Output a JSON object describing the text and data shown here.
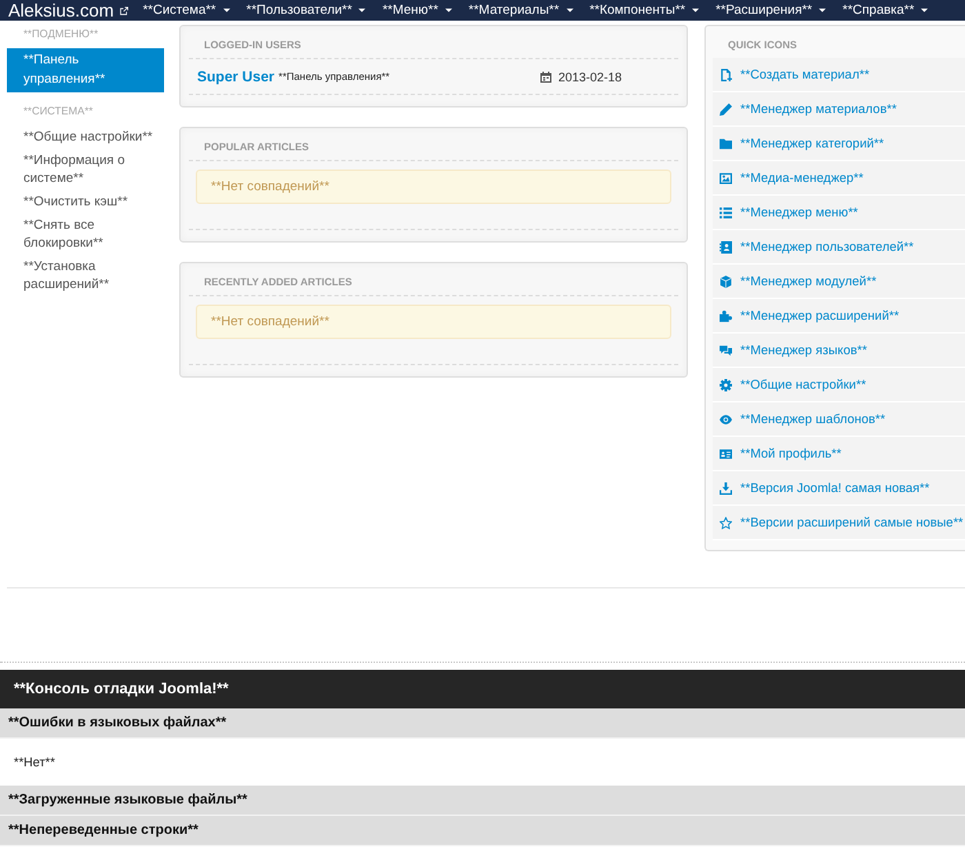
{
  "navbar": {
    "brand": "Aleksius.com",
    "menus": [
      {
        "label": "**Система**"
      },
      {
        "label": "**Пользователи**"
      },
      {
        "label": "**Меню**"
      },
      {
        "label": "**Материалы**"
      },
      {
        "label": "**Компоненты**"
      },
      {
        "label": "**Расширения**"
      },
      {
        "label": "**Справка**"
      }
    ]
  },
  "sidebar": {
    "sections": [
      {
        "title": "**ПОДМЕНЮ**",
        "items": [
          {
            "label": "**Панель управления**",
            "selected": true
          }
        ]
      },
      {
        "title": "**СИСТЕМА**",
        "items": [
          {
            "label": "**Общие настройки**",
            "selected": false
          },
          {
            "label": "**Информация о системе**",
            "selected": false
          },
          {
            "label": "**Очистить кэш**",
            "selected": false
          },
          {
            "label": "**Снять все блокировки**",
            "selected": false
          },
          {
            "label": "**Установка расширений**",
            "selected": false
          }
        ]
      }
    ]
  },
  "panels": [
    {
      "kind": "users",
      "title": "LOGGED-IN USERS",
      "users": [
        {
          "name": "Super User",
          "location": "**Панель управления**",
          "date": "2013-02-18"
        }
      ]
    },
    {
      "kind": "notice",
      "title": "POPULAR ARTICLES",
      "message": "**Нет совпадений**"
    },
    {
      "kind": "notice",
      "title": "RECENTLY ADDED ARTICLES",
      "message": "**Нет совпадений**"
    }
  ],
  "quick_icons": {
    "title": "QUICK ICONS",
    "items": [
      {
        "label": "**Создать материал**"
      },
      {
        "label": "**Менеджер материалов**"
      },
      {
        "label": "**Менеджер категорий**"
      },
      {
        "label": "**Медиа-менеджер**"
      },
      {
        "label": "**Менеджер меню**"
      },
      {
        "label": "**Менеджер пользователей**"
      },
      {
        "label": "**Менеджер модулей**"
      },
      {
        "label": "**Менеджер расширений**"
      },
      {
        "label": "**Менеджер языков**"
      },
      {
        "label": "**Общие настройки**"
      },
      {
        "label": "**Менеджер шаблонов**"
      },
      {
        "label": "**Мой профиль**"
      },
      {
        "label": "**Версия Joomla! самая новая**"
      },
      {
        "label": "**Версии расширений самые новые**"
      }
    ]
  },
  "debug_console": {
    "title": "**Консоль отладки Joomla!**",
    "sections": [
      {
        "title": "**Ошибки в языковых файлах**",
        "body": "**Нет**"
      },
      {
        "title": "**Загруженные языковые файлы**"
      },
      {
        "title": "**Непереведенные строки**"
      }
    ]
  }
}
